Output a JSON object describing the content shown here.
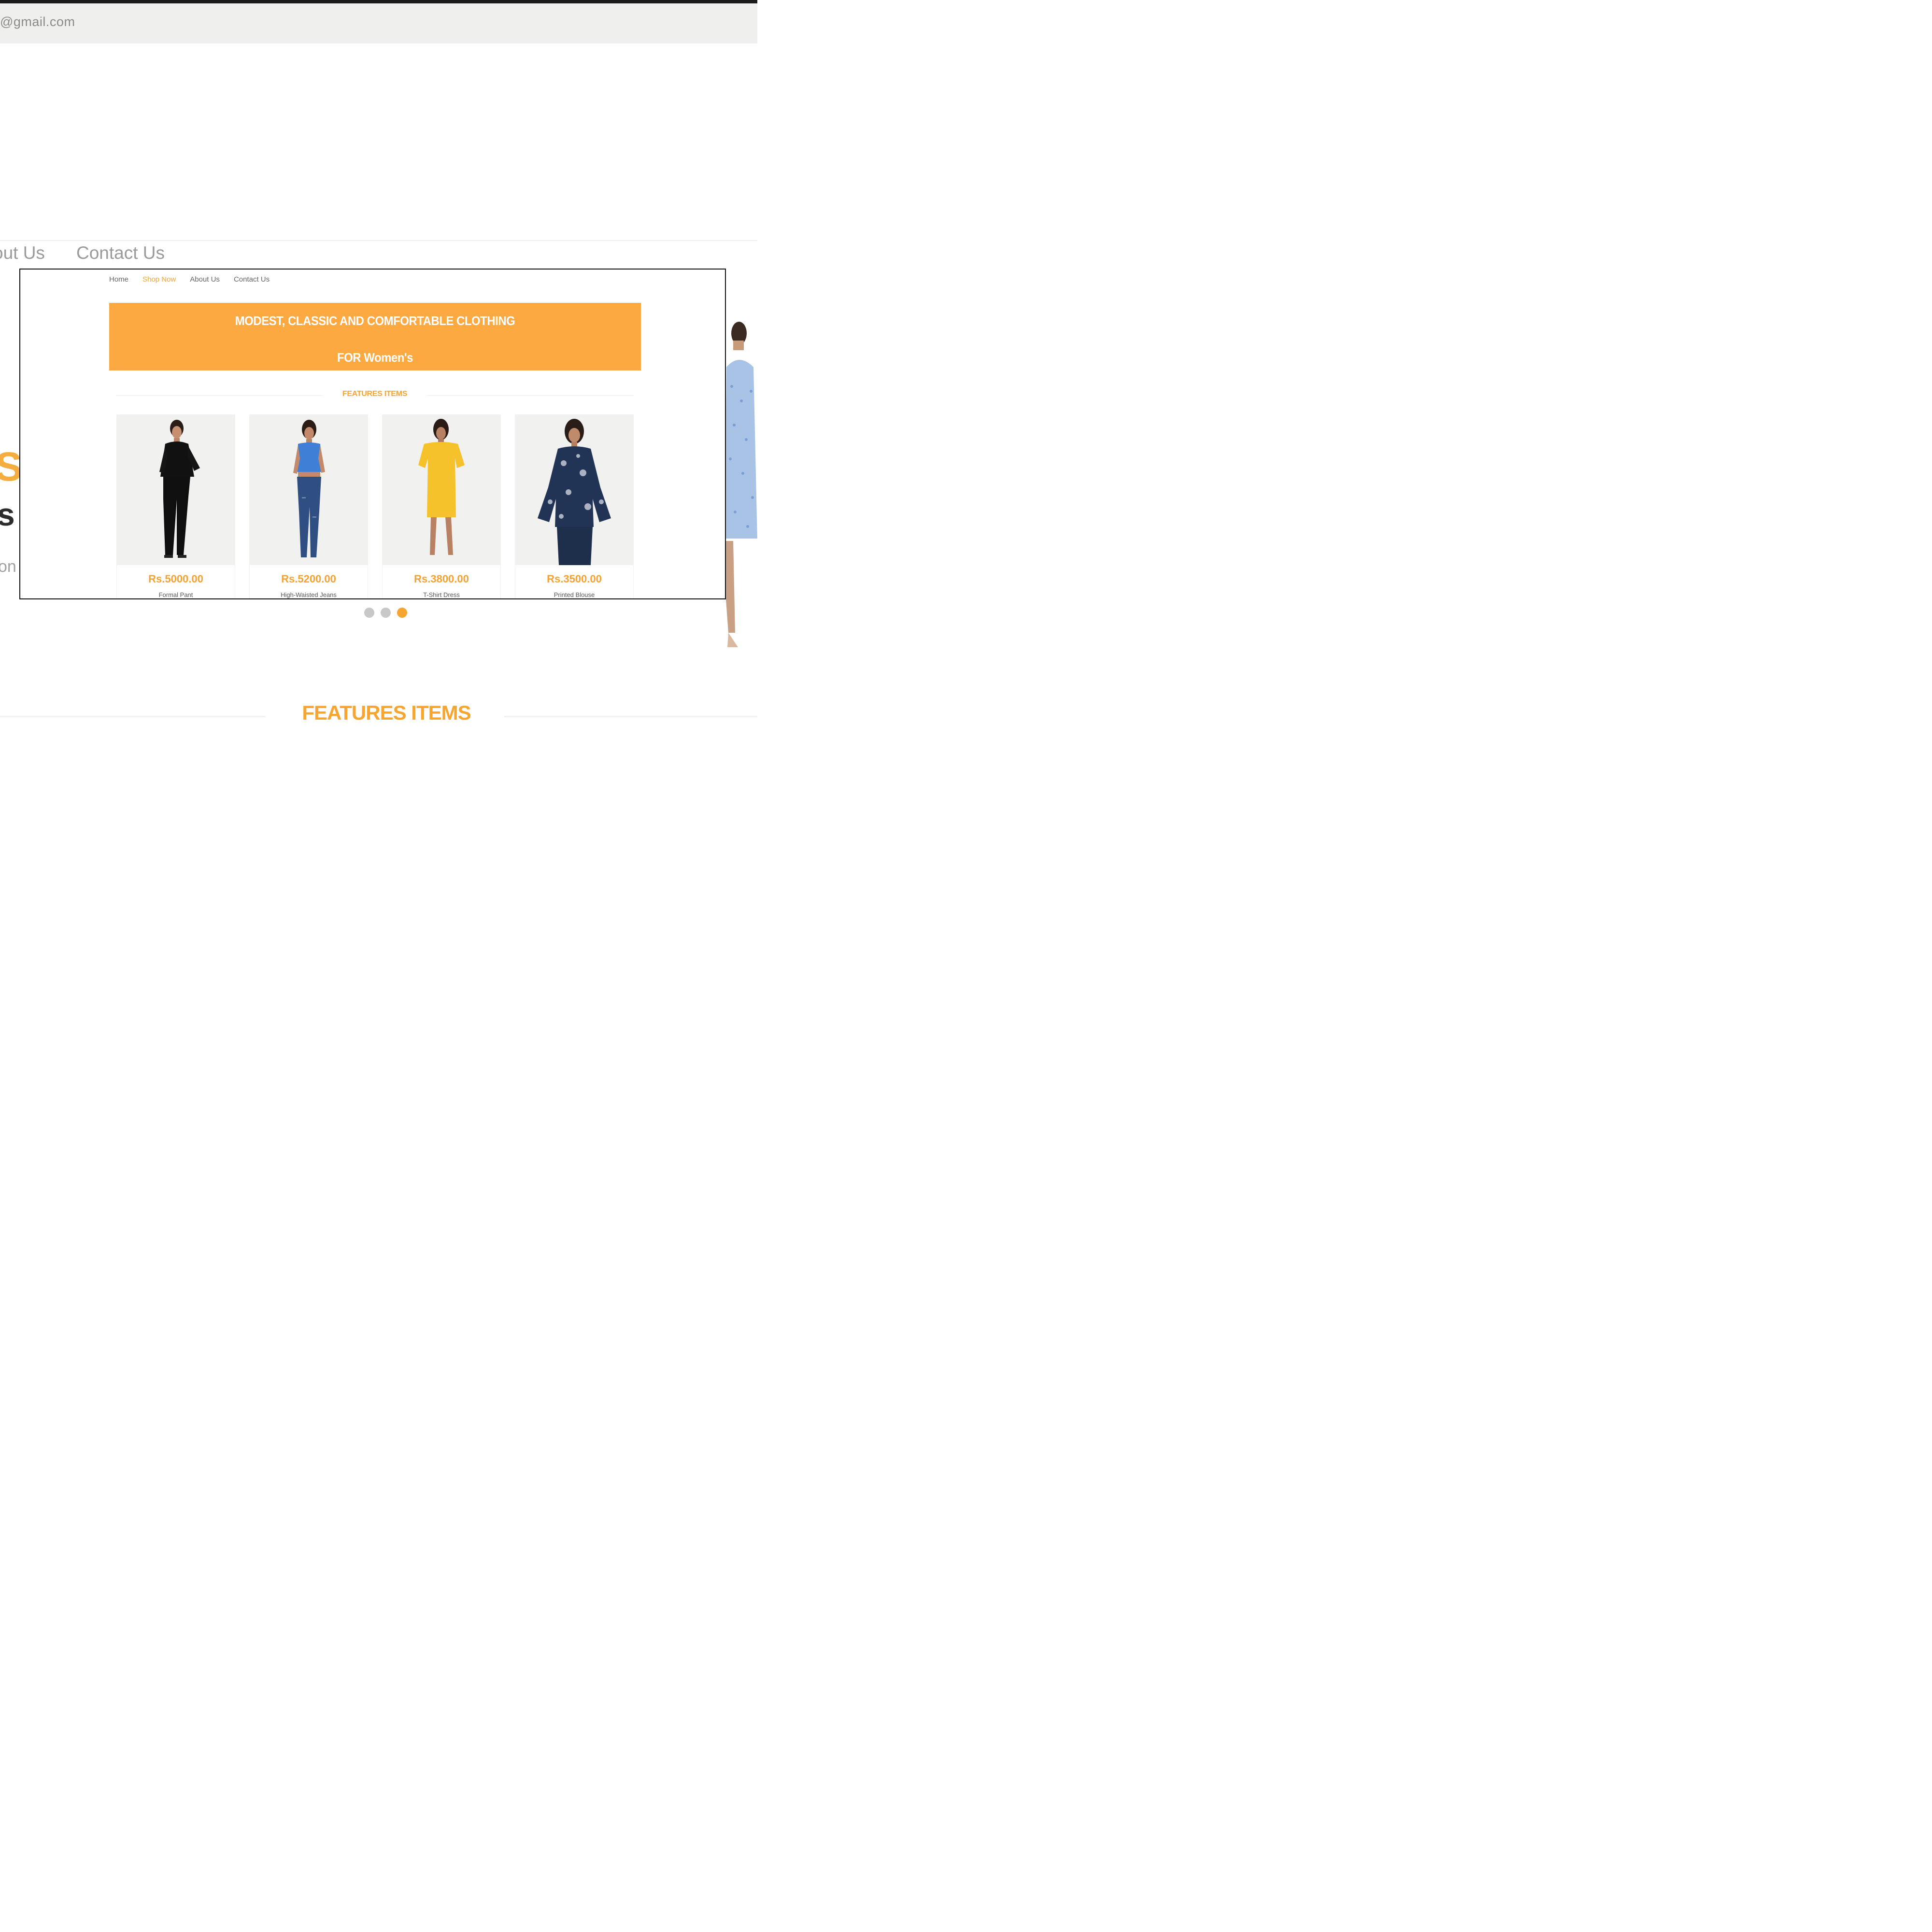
{
  "background": {
    "email_fragment": "@gmail.com",
    "nav": [
      "out Us",
      "Contact Us"
    ],
    "hero_fragments": [
      "S",
      "s",
      "on"
    ],
    "features_title": "FEATURES ITEMS",
    "carousel": {
      "count": 3,
      "active_index": 2
    }
  },
  "overlay": {
    "nav": [
      {
        "label": "Home",
        "active": false
      },
      {
        "label": "Shop Now",
        "active": true
      },
      {
        "label": "About Us",
        "active": false
      },
      {
        "label": "Contact Us",
        "active": false
      }
    ],
    "banner": {
      "line1": "MODEST, CLASSIC AND COMFORTABLE CLOTHING",
      "line2": "FOR Women's"
    },
    "features_title": "FEATURES ITEMS",
    "products": [
      {
        "price": "Rs.5000.00",
        "name": "Formal Pant",
        "image": "woman-black-outfit"
      },
      {
        "price": "Rs.5200.00",
        "name": "High-Waisted Jeans",
        "image": "woman-blue-crop-top-jeans"
      },
      {
        "price": "Rs.3800.00",
        "name": "T-Shirt Dress",
        "image": "woman-yellow-tshirt-dress"
      },
      {
        "price": "Rs.3500.00",
        "name": "Printed Blouse",
        "image": "woman-navy-printed-blouse"
      }
    ]
  },
  "colors": {
    "accent": "#f6a531",
    "banner": "#fba940",
    "nav_text": "#666666"
  }
}
